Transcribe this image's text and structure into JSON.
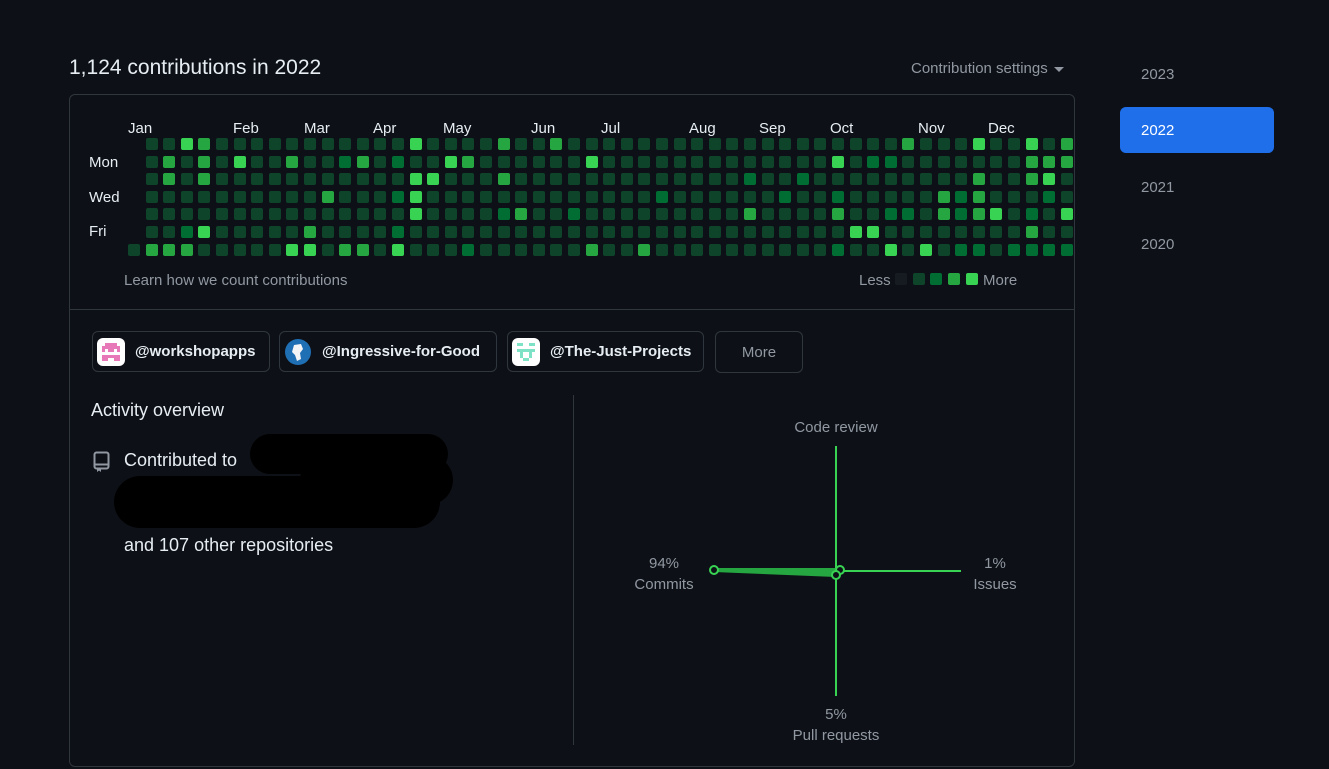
{
  "summary": {
    "heading": "1,124 contributions in 2022",
    "settings_label": "Contribution settings"
  },
  "calendar": {
    "months": [
      "Jan",
      "Feb",
      "Mar",
      "Apr",
      "May",
      "Jun",
      "Jul",
      "Aug",
      "Sep",
      "Oct",
      "Nov",
      "Dec"
    ],
    "day_labels": [
      "Mon",
      "Wed",
      "Fri"
    ],
    "learn_link": "Learn how we count contributions",
    "legend_less": "Less",
    "legend_more": "More",
    "level_colors": [
      "#161b22",
      "#0e4429",
      "#006d32",
      "#26a641",
      "#39d353"
    ],
    "weeks": [
      [
        null,
        null,
        null,
        null,
        null,
        null,
        1
      ],
      [
        1,
        1,
        1,
        1,
        1,
        1,
        3
      ],
      [
        1,
        3,
        3,
        1,
        1,
        1,
        3
      ],
      [
        4,
        1,
        1,
        1,
        1,
        2,
        3
      ],
      [
        3,
        3,
        3,
        1,
        1,
        4,
        1
      ],
      [
        1,
        1,
        1,
        1,
        1,
        1,
        1
      ],
      [
        1,
        4,
        1,
        1,
        1,
        1,
        1
      ],
      [
        1,
        1,
        1,
        1,
        1,
        1,
        1
      ],
      [
        1,
        1,
        1,
        1,
        1,
        1,
        1
      ],
      [
        1,
        3,
        1,
        1,
        1,
        1,
        4
      ],
      [
        1,
        1,
        1,
        1,
        1,
        3,
        4
      ],
      [
        1,
        1,
        1,
        3,
        1,
        1,
        1
      ],
      [
        1,
        2,
        1,
        1,
        1,
        1,
        3
      ],
      [
        1,
        3,
        1,
        1,
        1,
        1,
        3
      ],
      [
        1,
        1,
        1,
        1,
        1,
        1,
        1
      ],
      [
        1,
        2,
        1,
        2,
        1,
        2,
        4
      ],
      [
        4,
        1,
        4,
        4,
        4,
        1,
        1
      ],
      [
        1,
        1,
        4,
        1,
        1,
        1,
        1
      ],
      [
        1,
        4,
        1,
        1,
        1,
        1,
        1
      ],
      [
        1,
        3,
        1,
        1,
        1,
        1,
        2
      ],
      [
        1,
        1,
        1,
        1,
        1,
        1,
        1
      ],
      [
        3,
        1,
        3,
        1,
        2,
        1,
        1
      ],
      [
        1,
        1,
        1,
        1,
        3,
        1,
        1
      ],
      [
        1,
        1,
        1,
        1,
        1,
        1,
        1
      ],
      [
        3,
        1,
        1,
        1,
        1,
        1,
        1
      ],
      [
        1,
        1,
        1,
        1,
        2,
        1,
        1
      ],
      [
        1,
        4,
        1,
        1,
        1,
        1,
        3
      ],
      [
        1,
        1,
        1,
        1,
        1,
        1,
        1
      ],
      [
        1,
        1,
        1,
        1,
        1,
        1,
        1
      ],
      [
        1,
        1,
        1,
        1,
        1,
        1,
        3
      ],
      [
        1,
        1,
        1,
        2,
        1,
        1,
        1
      ],
      [
        1,
        1,
        1,
        1,
        1,
        1,
        1
      ],
      [
        1,
        1,
        1,
        1,
        1,
        1,
        1
      ],
      [
        1,
        1,
        1,
        1,
        1,
        1,
        1
      ],
      [
        1,
        1,
        1,
        1,
        1,
        1,
        1
      ],
      [
        1,
        1,
        2,
        1,
        3,
        1,
        1
      ],
      [
        1,
        1,
        1,
        1,
        1,
        1,
        1
      ],
      [
        1,
        1,
        1,
        2,
        1,
        1,
        1
      ],
      [
        1,
        1,
        2,
        1,
        1,
        1,
        1
      ],
      [
        1,
        1,
        1,
        1,
        1,
        1,
        1
      ],
      [
        1,
        4,
        1,
        2,
        3,
        1,
        2
      ],
      [
        1,
        1,
        1,
        1,
        1,
        4,
        1
      ],
      [
        1,
        2,
        1,
        1,
        1,
        4,
        1
      ],
      [
        1,
        2,
        1,
        1,
        2,
        1,
        4
      ],
      [
        3,
        1,
        1,
        1,
        2,
        1,
        1
      ],
      [
        1,
        1,
        1,
        1,
        1,
        1,
        4
      ],
      [
        1,
        1,
        1,
        3,
        3,
        1,
        1
      ],
      [
        1,
        1,
        1,
        2,
        2,
        1,
        2
      ],
      [
        4,
        1,
        3,
        3,
        3,
        1,
        2
      ],
      [
        1,
        1,
        1,
        1,
        4,
        1,
        1
      ],
      [
        1,
        1,
        1,
        1,
        1,
        1,
        2
      ],
      [
        4,
        3,
        3,
        1,
        2,
        3,
        2
      ],
      [
        1,
        3,
        4,
        2,
        1,
        1,
        2
      ],
      [
        3,
        3,
        1,
        1,
        4,
        1,
        2
      ]
    ]
  },
  "orgs": [
    {
      "label": "@workshopapps",
      "avatar_color": "#e879b8",
      "icon": "invader-avatar-icon"
    },
    {
      "label": "@Ingressive-for-Good",
      "avatar_color": "#1f6fb5",
      "icon": "globe-avatar-icon"
    },
    {
      "label": "@The-Just-Projects",
      "avatar_color": "#7ee2c7",
      "icon": "pixel-avatar-icon"
    }
  ],
  "orgs_more_label": "More",
  "activity": {
    "title": "Activity overview",
    "contributed_prefix": "Contributed to",
    "other_repos": "and 107 other repositories"
  },
  "overview_chart": {
    "code_review_label": "Code review",
    "commits_pct": "94%",
    "commits_label": "Commits",
    "issues_pct": "1%",
    "issues_label": "Issues",
    "pull_requests_pct": "5%",
    "pull_requests_label": "Pull requests",
    "accent_color": "#39d353"
  },
  "years": [
    "2023",
    "2022",
    "2021",
    "2020"
  ],
  "active_year": "2022"
}
